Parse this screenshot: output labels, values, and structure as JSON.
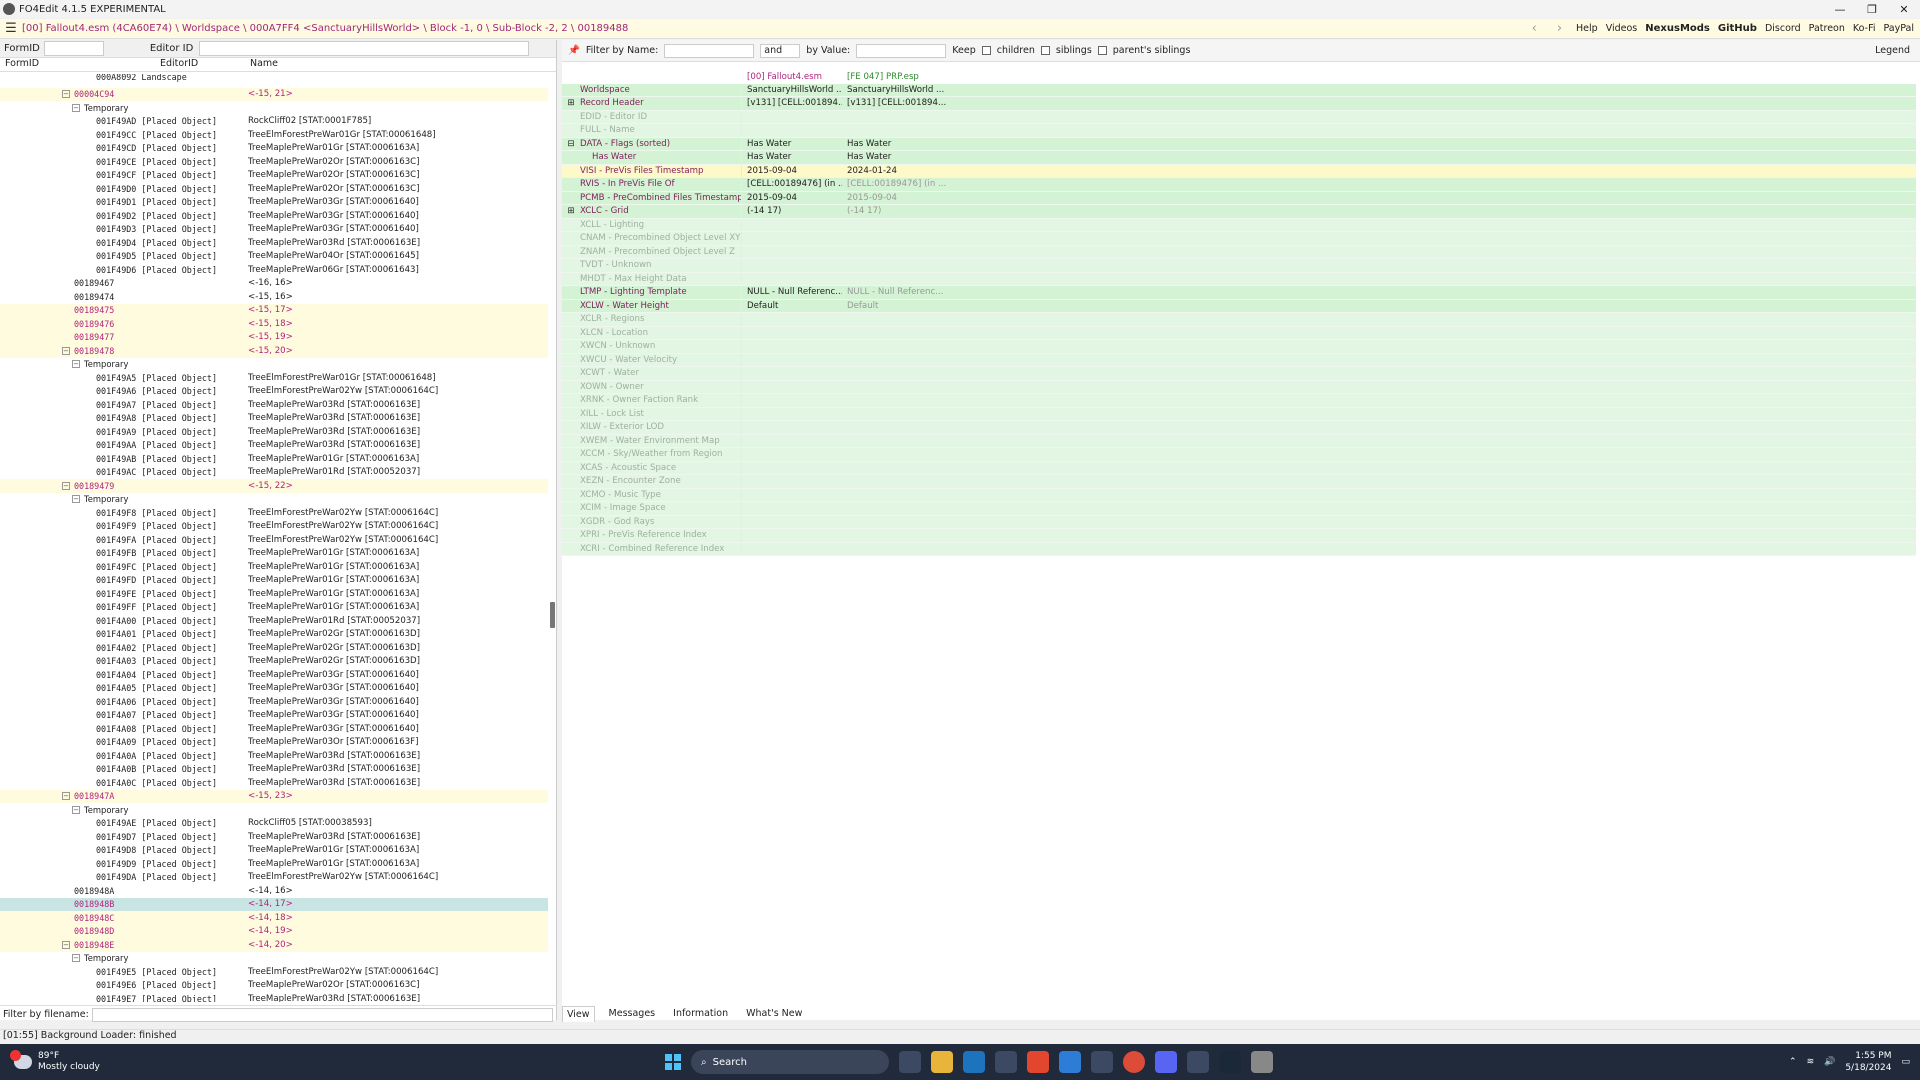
{
  "window": {
    "title": "FO4Edit 4.1.5 EXPERIMENTAL",
    "buttons": [
      "—",
      "❐",
      "✕"
    ]
  },
  "pathbar": {
    "path": "[00] Fallout4.esm (4CA60E74) \\ Worldspace \\ 000A7FF4 <SanctuaryHillsWorld> \\ Block -1, 0 \\ Sub-Block -2, 2 \\ 00189488",
    "links": [
      "Help",
      "Videos",
      "NexusMods",
      "GitHub",
      "Discord",
      "Patreon",
      "Ko-Fi",
      "PayPal"
    ]
  },
  "left": {
    "formid_label": "FormID",
    "editorid_label": "Editor ID",
    "columns": [
      "FormID",
      "EditorID",
      "Name"
    ],
    "filter_label": "Filter by filename:",
    "rows": [
      {
        "c1": "000A8092  Landscape",
        "c2": "",
        "indent": 96,
        "cut": true
      },
      {
        "c1": "00004C94",
        "c2": "<-15, 21>",
        "indent": 74,
        "pink": true,
        "yellow": true,
        "exp": "−"
      },
      {
        "c1": "Temporary",
        "c2": "",
        "indent": 84,
        "exp": "−",
        "plain": true
      },
      {
        "c1": "001F49AD [Placed Object]",
        "c2": "RockCliff02 [STAT:0001F785]",
        "indent": 96
      },
      {
        "c1": "001F49CC [Placed Object]",
        "c2": "TreeElmForestPreWar01Gr [STAT:00061648]",
        "indent": 96
      },
      {
        "c1": "001F49CD [Placed Object]",
        "c2": "TreeMaplePreWar01Gr [STAT:0006163A]",
        "indent": 96
      },
      {
        "c1": "001F49CE [Placed Object]",
        "c2": "TreeMaplePreWar02Or [STAT:0006163C]",
        "indent": 96
      },
      {
        "c1": "001F49CF [Placed Object]",
        "c2": "TreeMaplePreWar02Or [STAT:0006163C]",
        "indent": 96
      },
      {
        "c1": "001F49D0 [Placed Object]",
        "c2": "TreeMaplePreWar02Or [STAT:0006163C]",
        "indent": 96
      },
      {
        "c1": "001F49D1 [Placed Object]",
        "c2": "TreeMaplePreWar03Gr [STAT:00061640]",
        "indent": 96
      },
      {
        "c1": "001F49D2 [Placed Object]",
        "c2": "TreeMaplePreWar03Gr [STAT:00061640]",
        "indent": 96
      },
      {
        "c1": "001F49D3 [Placed Object]",
        "c2": "TreeMaplePreWar03Gr [STAT:00061640]",
        "indent": 96
      },
      {
        "c1": "001F49D4 [Placed Object]",
        "c2": "TreeMaplePreWar03Rd [STAT:0006163E]",
        "indent": 96
      },
      {
        "c1": "001F49D5 [Placed Object]",
        "c2": "TreeMaplePreWar04Or [STAT:00061645]",
        "indent": 96
      },
      {
        "c1": "001F49D6 [Placed Object]",
        "c2": "TreeMaplePreWar06Gr [STAT:00061643]",
        "indent": 96
      },
      {
        "c1": "00189467",
        "c2": "<-16, 16>",
        "indent": 74
      },
      {
        "c1": "00189474",
        "c2": "<-15, 16>",
        "indent": 74
      },
      {
        "c1": "00189475",
        "c2": "<-15, 17>",
        "indent": 74,
        "pink": true,
        "yellow": true
      },
      {
        "c1": "00189476",
        "c2": "<-15, 18>",
        "indent": 74,
        "pink": true,
        "yellow": true
      },
      {
        "c1": "00189477",
        "c2": "<-15, 19>",
        "indent": 74,
        "pink": true,
        "yellow": true
      },
      {
        "c1": "00189478",
        "c2": "<-15, 20>",
        "indent": 74,
        "pink": true,
        "yellow": true,
        "exp": "−"
      },
      {
        "c1": "Temporary",
        "c2": "",
        "indent": 84,
        "exp": "−",
        "plain": true
      },
      {
        "c1": "001F49A5 [Placed Object]",
        "c2": "TreeElmForestPreWar01Gr [STAT:00061648]",
        "indent": 96
      },
      {
        "c1": "001F49A6 [Placed Object]",
        "c2": "TreeElmForestPreWar02Yw [STAT:0006164C]",
        "indent": 96
      },
      {
        "c1": "001F49A7 [Placed Object]",
        "c2": "TreeMaplePreWar03Rd [STAT:0006163E]",
        "indent": 96
      },
      {
        "c1": "001F49A8 [Placed Object]",
        "c2": "TreeMaplePreWar03Rd [STAT:0006163E]",
        "indent": 96
      },
      {
        "c1": "001F49A9 [Placed Object]",
        "c2": "TreeMaplePreWar03Rd [STAT:0006163E]",
        "indent": 96
      },
      {
        "c1": "001F49AA [Placed Object]",
        "c2": "TreeMaplePreWar03Rd [STAT:0006163E]",
        "indent": 96
      },
      {
        "c1": "001F49AB [Placed Object]",
        "c2": "TreeMaplePreWar01Gr [STAT:0006163A]",
        "indent": 96
      },
      {
        "c1": "001F49AC [Placed Object]",
        "c2": "TreeMaplePreWar01Rd [STAT:00052037]",
        "indent": 96
      },
      {
        "c1": "00189479",
        "c2": "<-15, 22>",
        "indent": 74,
        "pink": true,
        "yellow": true,
        "exp": "−"
      },
      {
        "c1": "Temporary",
        "c2": "",
        "indent": 84,
        "exp": "−",
        "plain": true
      },
      {
        "c1": "001F49F8 [Placed Object]",
        "c2": "TreeElmForestPreWar02Yw [STAT:0006164C]",
        "indent": 96
      },
      {
        "c1": "001F49F9 [Placed Object]",
        "c2": "TreeElmForestPreWar02Yw [STAT:0006164C]",
        "indent": 96
      },
      {
        "c1": "001F49FA [Placed Object]",
        "c2": "TreeElmForestPreWar02Yw [STAT:0006164C]",
        "indent": 96
      },
      {
        "c1": "001F49FB [Placed Object]",
        "c2": "TreeMaplePreWar01Gr [STAT:0006163A]",
        "indent": 96
      },
      {
        "c1": "001F49FC [Placed Object]",
        "c2": "TreeMaplePreWar01Gr [STAT:0006163A]",
        "indent": 96
      },
      {
        "c1": "001F49FD [Placed Object]",
        "c2": "TreeMaplePreWar01Gr [STAT:0006163A]",
        "indent": 96
      },
      {
        "c1": "001F49FE [Placed Object]",
        "c2": "TreeMaplePreWar01Gr [STAT:0006163A]",
        "indent": 96
      },
      {
        "c1": "001F49FF [Placed Object]",
        "c2": "TreeMaplePreWar01Gr [STAT:0006163A]",
        "indent": 96
      },
      {
        "c1": "001F4A00 [Placed Object]",
        "c2": "TreeMaplePreWar01Rd [STAT:00052037]",
        "indent": 96
      },
      {
        "c1": "001F4A01 [Placed Object]",
        "c2": "TreeMaplePreWar02Gr [STAT:0006163D]",
        "indent": 96
      },
      {
        "c1": "001F4A02 [Placed Object]",
        "c2": "TreeMaplePreWar02Gr [STAT:0006163D]",
        "indent": 96
      },
      {
        "c1": "001F4A03 [Placed Object]",
        "c2": "TreeMaplePreWar02Gr [STAT:0006163D]",
        "indent": 96
      },
      {
        "c1": "001F4A04 [Placed Object]",
        "c2": "TreeMaplePreWar03Gr [STAT:00061640]",
        "indent": 96
      },
      {
        "c1": "001F4A05 [Placed Object]",
        "c2": "TreeMaplePreWar03Gr [STAT:00061640]",
        "indent": 96
      },
      {
        "c1": "001F4A06 [Placed Object]",
        "c2": "TreeMaplePreWar03Gr [STAT:00061640]",
        "indent": 96
      },
      {
        "c1": "001F4A07 [Placed Object]",
        "c2": "TreeMaplePreWar03Gr [STAT:00061640]",
        "indent": 96
      },
      {
        "c1": "001F4A08 [Placed Object]",
        "c2": "TreeMaplePreWar03Gr [STAT:00061640]",
        "indent": 96
      },
      {
        "c1": "001F4A09 [Placed Object]",
        "c2": "TreeMaplePreWar03Or [STAT:0006163F]",
        "indent": 96
      },
      {
        "c1": "001F4A0A [Placed Object]",
        "c2": "TreeMaplePreWar03Rd [STAT:0006163E]",
        "indent": 96
      },
      {
        "c1": "001F4A0B [Placed Object]",
        "c2": "TreeMaplePreWar03Rd [STAT:0006163E]",
        "indent": 96
      },
      {
        "c1": "001F4A0C [Placed Object]",
        "c2": "TreeMaplePreWar03Rd [STAT:0006163E]",
        "indent": 96
      },
      {
        "c1": "0018947A",
        "c2": "<-15, 23>",
        "indent": 74,
        "pink": true,
        "yellow": true,
        "exp": "−"
      },
      {
        "c1": "Temporary",
        "c2": "",
        "indent": 84,
        "exp": "−",
        "plain": true
      },
      {
        "c1": "001F49AE [Placed Object]",
        "c2": "RockCliff05 [STAT:00038593]",
        "indent": 96
      },
      {
        "c1": "001F49D7 [Placed Object]",
        "c2": "TreeMaplePreWar03Rd [STAT:0006163E]",
        "indent": 96
      },
      {
        "c1": "001F49D8 [Placed Object]",
        "c2": "TreeMaplePreWar01Gr [STAT:0006163A]",
        "indent": 96
      },
      {
        "c1": "001F49D9 [Placed Object]",
        "c2": "TreeMaplePreWar01Gr [STAT:0006163A]",
        "indent": 96
      },
      {
        "c1": "001F49DA [Placed Object]",
        "c2": "TreeElmForestPreWar02Yw [STAT:0006164C]",
        "indent": 96
      },
      {
        "c1": "0018948A",
        "c2": "<-14, 16>",
        "indent": 74
      },
      {
        "c1": "0018948B",
        "c2": "<-14, 17>",
        "indent": 74,
        "pink": true,
        "sel": true
      },
      {
        "c1": "0018948C",
        "c2": "<-14, 18>",
        "indent": 74,
        "pink": true,
        "yellow": true
      },
      {
        "c1": "0018948D",
        "c2": "<-14, 19>",
        "indent": 74,
        "pink": true,
        "yellow": true
      },
      {
        "c1": "0018948E",
        "c2": "<-14, 20>",
        "indent": 74,
        "pink": true,
        "yellow": true,
        "exp": "−"
      },
      {
        "c1": "Temporary",
        "c2": "",
        "indent": 84,
        "exp": "−",
        "plain": true
      },
      {
        "c1": "001F49E5 [Placed Object]",
        "c2": "TreeElmForestPreWar02Yw [STAT:0006164C]",
        "indent": 96
      },
      {
        "c1": "001F49E6 [Placed Object]",
        "c2": "TreeMaplePreWar02Or [STAT:0006163C]",
        "indent": 96
      },
      {
        "c1": "001F49E7 [Placed Object]",
        "c2": "TreeMaplePreWar03Rd [STAT:0006163E]",
        "indent": 96
      }
    ]
  },
  "right": {
    "filter": {
      "name_label": "Filter by Name:",
      "op": "and",
      "value_label": "by Value:",
      "keep_label": "Keep",
      "chk1": "children",
      "chk2": "siblings",
      "chk3": "parent's siblings",
      "legend": "Legend"
    },
    "headers": [
      "[00] Fallout4.esm",
      "[FE 047] PRP.esp"
    ],
    "rows": [
      {
        "n": "Worldspace",
        "v1": "SanctuaryHillsWorld ...",
        "v2": "SanctuaryHillsWorld ...",
        "t": "g"
      },
      {
        "n": "Record Header",
        "v1": "[v131] [CELL:001894...",
        "v2": "[v131] [CELL:001894...",
        "t": "g",
        "ex": "+"
      },
      {
        "n": "EDID - Editor ID",
        "v1": "",
        "v2": "",
        "t": "e"
      },
      {
        "n": "FULL - Name",
        "v1": "",
        "v2": "",
        "t": "e"
      },
      {
        "n": "DATA - Flags (sorted)",
        "v1": "Has Water",
        "v2": "Has Water",
        "t": "g",
        "ex": "−"
      },
      {
        "n": "   Has Water",
        "v1": "Has Water",
        "v2": "Has Water",
        "t": "g",
        "sub": true
      },
      {
        "n": "VISI - PreVis Files Timestamp",
        "v1": "2015-09-04",
        "v2": "2024-01-24",
        "t": "y"
      },
      {
        "n": "RVIS - In PreVis File Of",
        "v1": "[CELL:00189476] (in ...",
        "v2": "[CELL:00189476] (in ...",
        "t": "g",
        "dim2": true
      },
      {
        "n": "PCMB - PreCombined Files Timestamp",
        "v1": "2015-09-04",
        "v2": "2015-09-04",
        "t": "g",
        "dim2": true
      },
      {
        "n": "XCLC - Grid",
        "v1": "(-14 17)",
        "v2": "(-14 17)",
        "t": "g",
        "ex": "+",
        "dim2": true
      },
      {
        "n": "XCLL - Lighting",
        "v1": "",
        "v2": "",
        "t": "e"
      },
      {
        "n": "CNAM - Precombined Object Level XY",
        "v1": "",
        "v2": "",
        "t": "e"
      },
      {
        "n": "ZNAM - Precombined Object Level Z",
        "v1": "",
        "v2": "",
        "t": "e"
      },
      {
        "n": "TVDT - Unknown",
        "v1": "",
        "v2": "",
        "t": "e"
      },
      {
        "n": "MHDT - Max Height Data",
        "v1": "",
        "v2": "",
        "t": "e"
      },
      {
        "n": "LTMP - Lighting Template",
        "v1": "NULL - Null Referenc...",
        "v2": "NULL - Null Referenc...",
        "t": "g",
        "dim2": true
      },
      {
        "n": "XCLW - Water Height",
        "v1": "Default",
        "v2": "Default",
        "t": "g",
        "dim2": true
      },
      {
        "n": "XCLR - Regions",
        "v1": "",
        "v2": "",
        "t": "e"
      },
      {
        "n": "XLCN - Location",
        "v1": "",
        "v2": "",
        "t": "e"
      },
      {
        "n": "XWCN - Unknown",
        "v1": "",
        "v2": "",
        "t": "e"
      },
      {
        "n": "XWCU - Water Velocity",
        "v1": "",
        "v2": "",
        "t": "e"
      },
      {
        "n": "XCWT - Water",
        "v1": "",
        "v2": "",
        "t": "e"
      },
      {
        "n": "XOWN - Owner",
        "v1": "",
        "v2": "",
        "t": "e"
      },
      {
        "n": "XRNK - Owner Faction Rank",
        "v1": "",
        "v2": "",
        "t": "e"
      },
      {
        "n": "XILL - Lock List",
        "v1": "",
        "v2": "",
        "t": "e"
      },
      {
        "n": "XILW - Exterior LOD",
        "v1": "",
        "v2": "",
        "t": "e"
      },
      {
        "n": "XWEM - Water Environment Map",
        "v1": "",
        "v2": "",
        "t": "e"
      },
      {
        "n": "XCCM - Sky/Weather from Region",
        "v1": "",
        "v2": "",
        "t": "e"
      },
      {
        "n": "XCAS - Acoustic Space",
        "v1": "",
        "v2": "",
        "t": "e"
      },
      {
        "n": "XEZN - Encounter Zone",
        "v1": "",
        "v2": "",
        "t": "e"
      },
      {
        "n": "XCMO - Music Type",
        "v1": "",
        "v2": "",
        "t": "e"
      },
      {
        "n": "XCIM - Image Space",
        "v1": "",
        "v2": "",
        "t": "e"
      },
      {
        "n": "XGDR - God Rays",
        "v1": "",
        "v2": "",
        "t": "e"
      },
      {
        "n": "XPRI - PreVis Reference Index",
        "v1": "",
        "v2": "",
        "t": "e"
      },
      {
        "n": "XCRI - Combined Reference Index",
        "v1": "",
        "v2": "",
        "t": "e"
      }
    ],
    "tabs": [
      "View",
      "Messages",
      "Information",
      "What's New"
    ]
  },
  "status": "[01:55] Background Loader: finished",
  "taskbar": {
    "temp": "89°F",
    "weather": "Mostly cloudy",
    "search": "Search",
    "time": "1:55 PM",
    "date": "5/18/2024",
    "badge": "1"
  }
}
